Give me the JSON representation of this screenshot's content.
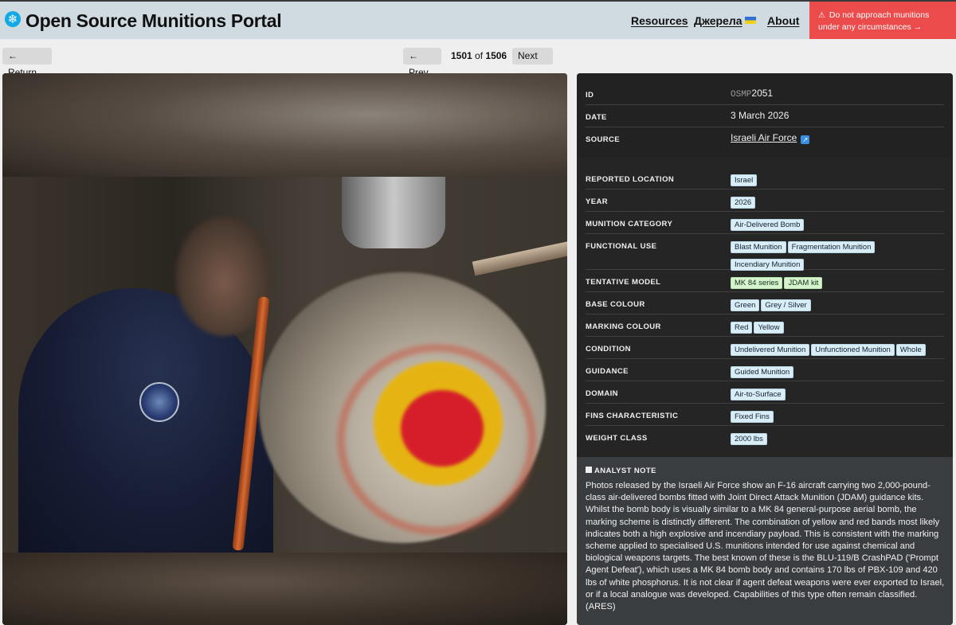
{
  "header": {
    "title": "Open Source Munitions Portal",
    "logo_icon": "snowflake-icon",
    "nav": {
      "resources": "Resources",
      "sources": "Джерела",
      "about": "About"
    },
    "warning": "Do not approach munitions under any circumstances →",
    "colors": {
      "bar": "#cfdbe1",
      "warning": "#ec4b4b"
    }
  },
  "nav": {
    "return": "← Return",
    "prev": "← Prev",
    "next": "Next →",
    "current": "1501",
    "of": "of",
    "total": "1506"
  },
  "record": {
    "id_label": "ID",
    "id_prefix": "OSMP",
    "id_number": "2051",
    "date_label": "DATE",
    "date": "3 March 2026",
    "source_label": "SOURCE",
    "source": "Israeli Air Force"
  },
  "attributes": [
    {
      "label": "REPORTED LOCATION",
      "tags": [
        "Israel"
      ]
    },
    {
      "label": "YEAR",
      "tags": [
        "2026"
      ]
    },
    {
      "label": "MUNITION CATEGORY",
      "tags": [
        "Air-Delivered Bomb"
      ]
    },
    {
      "label": "FUNCTIONAL USE",
      "tags": [
        "Blast Munition",
        "Fragmentation Munition",
        "Incendiary Munition"
      ]
    },
    {
      "label": "TENTATIVE MODEL",
      "tags": [
        "MK 84 series",
        "JDAM kit"
      ],
      "style": "green"
    },
    {
      "label": "BASE COLOUR",
      "tags": [
        "Green",
        "Grey / Silver"
      ]
    },
    {
      "label": "MARKING COLOUR",
      "tags": [
        "Red",
        "Yellow"
      ]
    },
    {
      "label": "CONDITION",
      "tags": [
        "Undelivered Munition",
        "Unfunctioned Munition",
        "Whole"
      ]
    },
    {
      "label": "GUIDANCE",
      "tags": [
        "Guided Munition"
      ]
    },
    {
      "label": "DOMAIN",
      "tags": [
        "Air-to-Surface"
      ]
    },
    {
      "label": "FINS CHARACTERISTIC",
      "tags": [
        "Fixed Fins"
      ]
    },
    {
      "label": "WEIGHT CLASS",
      "tags": [
        "2000 lbs"
      ]
    }
  ],
  "note": {
    "title": "ANALYST NOTE",
    "body": "Photos released by the Israeli Air Force show an F-16 aircraft carrying two 2,000-pound-class air-delivered bombs fitted with Joint Direct Attack Munition (JDAM) guidance kits. Whilst the bomb body is visually similar to a MK 84 general-purpose aerial bomb, the marking scheme is distinctly different. The combination of yellow and red bands most likely indicates both a high explosive and incendiary payload. This is consistent with the marking scheme applied to specialised U.S. munitions intended for use against chemical and biological weapons targets. The best known of these is the BLU-119/B CrashPAD ('Prompt Agent Defeat'), which uses a MK 84 bomb body and contains 170 lbs of PBX-109 and 420 lbs of white phosphorus. It is not clear if agent defeat weapons were ever exported to Israel, or if a local analogue was developed. Capabilities of this type often remain classified. (ARES)"
  }
}
